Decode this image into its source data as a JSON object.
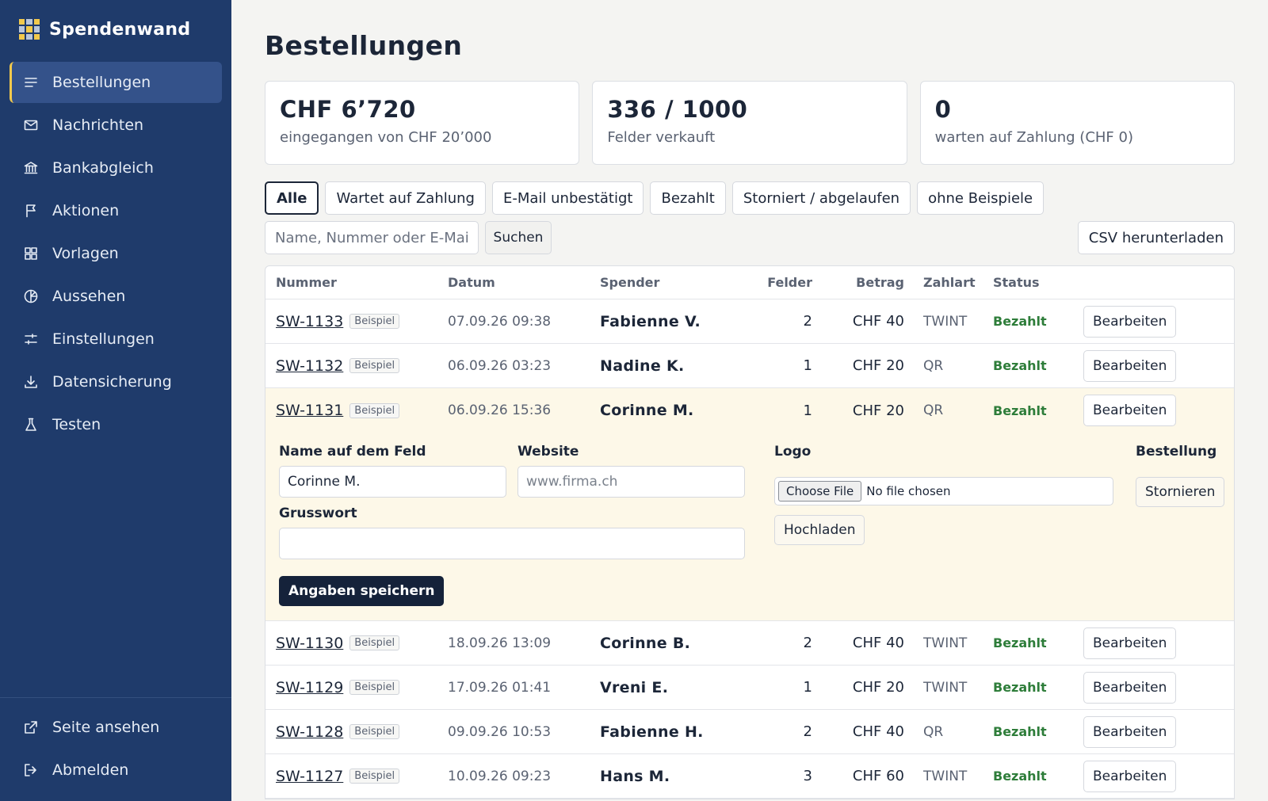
{
  "app": {
    "name": "Spendenwand"
  },
  "sidebar": {
    "items": [
      {
        "label": "Bestellungen",
        "icon": "list-icon",
        "active": true
      },
      {
        "label": "Nachrichten",
        "icon": "mail-icon"
      },
      {
        "label": "Bankabgleich",
        "icon": "bank-icon"
      },
      {
        "label": "Aktionen",
        "icon": "flag-icon"
      },
      {
        "label": "Vorlagen",
        "icon": "grid-icon"
      },
      {
        "label": "Aussehen",
        "icon": "palette-icon"
      },
      {
        "label": "Einstellungen",
        "icon": "sliders-icon"
      },
      {
        "label": "Datensicherung",
        "icon": "download-icon"
      },
      {
        "label": "Testen",
        "icon": "flask-icon"
      }
    ],
    "bottom_items": [
      {
        "label": "Seite ansehen",
        "icon": "external-link-icon"
      },
      {
        "label": "Abmelden",
        "icon": "logout-icon"
      }
    ]
  },
  "page": {
    "title": "Bestellungen"
  },
  "stats": [
    {
      "value": "CHF 6’720",
      "label": "eingegangen von CHF 20’000"
    },
    {
      "value": "336 / 1000",
      "label": "Felder verkauft"
    },
    {
      "value": "0",
      "label": "warten auf Zahlung (CHF 0)"
    }
  ],
  "filters": [
    "Alle",
    "Wartet auf Zahlung",
    "E-Mail unbestätigt",
    "Bezahlt",
    "Storniert / abgelaufen",
    "ohne Beispiele"
  ],
  "search": {
    "placeholder": "Name, Nummer oder E-Mail",
    "button": "Suchen",
    "csv": "CSV herunterladen"
  },
  "table": {
    "headers": {
      "number": "Nummer",
      "date": "Datum",
      "donor": "Spender",
      "fields": "Felder",
      "amount": "Betrag",
      "payment": "Zahlart",
      "status": "Status"
    },
    "badge": "Beispiel",
    "edit_label": "Bearbeiten",
    "rows": [
      {
        "number": "SW-1133",
        "date": "07.09.26 09:38",
        "donor": "Fabienne V.",
        "fields": "2",
        "amount": "CHF 40",
        "payment": "TWINT",
        "status": "Bezahlt"
      },
      {
        "number": "SW-1132",
        "date": "06.09.26 03:23",
        "donor": "Nadine K.",
        "fields": "1",
        "amount": "CHF 20",
        "payment": "QR",
        "status": "Bezahlt"
      },
      {
        "number": "SW-1131",
        "date": "06.09.26 15:36",
        "donor": "Corinne M.",
        "fields": "1",
        "amount": "CHF 20",
        "payment": "QR",
        "status": "Bezahlt"
      },
      {
        "number": "SW-1130",
        "date": "18.09.26 13:09",
        "donor": "Corinne B.",
        "fields": "2",
        "amount": "CHF 40",
        "payment": "TWINT",
        "status": "Bezahlt"
      },
      {
        "number": "SW-1129",
        "date": "17.09.26 01:41",
        "donor": "Vreni E.",
        "fields": "1",
        "amount": "CHF 20",
        "payment": "TWINT",
        "status": "Bezahlt"
      },
      {
        "number": "SW-1128",
        "date": "09.09.26 10:53",
        "donor": "Fabienne H.",
        "fields": "2",
        "amount": "CHF 40",
        "payment": "QR",
        "status": "Bezahlt"
      },
      {
        "number": "SW-1127",
        "date": "10.09.26 09:23",
        "donor": "Hans M.",
        "fields": "3",
        "amount": "CHF 60",
        "payment": "TWINT",
        "status": "Bezahlt"
      }
    ]
  },
  "edit_panel": {
    "name_label": "Name auf dem Feld",
    "name_value": "Corinne M.",
    "website_label": "Website",
    "website_placeholder": "www.firma.ch",
    "logo_label": "Logo",
    "file_button": "Choose File",
    "file_status": "No file chosen",
    "upload_button": "Hochladen",
    "order_label": "Bestellung",
    "cancel_button": "Stornieren",
    "greeting_label": "Grusswort",
    "greeting_value": "",
    "save_button": "Angaben speichern"
  },
  "colors": {
    "sidebar": "#1f3b6b",
    "accent": "#f2c94c",
    "paid": "#2e7d3a",
    "highlight_row": "#fdf8e8"
  }
}
